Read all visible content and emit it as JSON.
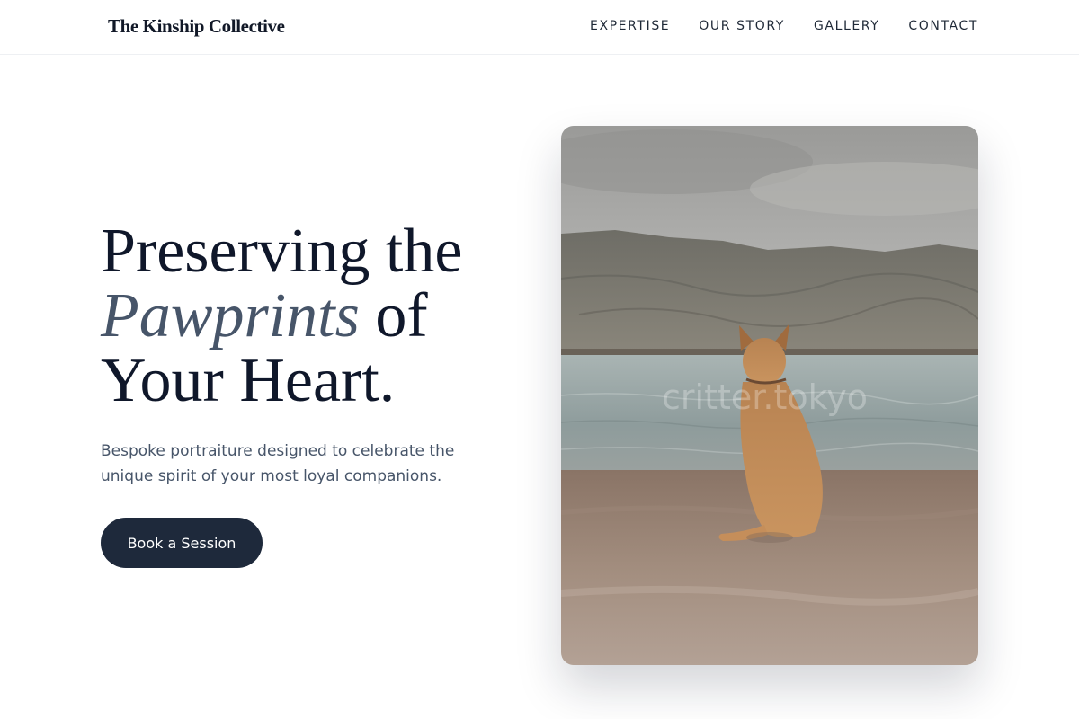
{
  "header": {
    "brand": "The Kinship Collective",
    "nav": [
      {
        "label": "EXPERTISE"
      },
      {
        "label": "OUR STORY"
      },
      {
        "label": "GALLERY"
      },
      {
        "label": "CONTACT"
      }
    ]
  },
  "hero": {
    "headline_line1": "Preserving the",
    "headline_accent": "Pawprints",
    "headline_line2_rest": " of",
    "headline_line3": "Your Heart.",
    "subcopy": "Bespoke portraiture designed to celebrate the unique spirit of your most loyal companions.",
    "cta_label": "Book a Session"
  },
  "photo": {
    "subject": "dog sitting on pebble shore facing lake and mountains",
    "watermark": "critter.tokyo"
  },
  "colors": {
    "brand_text": "#111827",
    "headline": "#0f172a",
    "accent_italic": "#475569",
    "body_text": "#475569",
    "cta_bg": "#1e293b",
    "cta_text": "#ffffff"
  }
}
